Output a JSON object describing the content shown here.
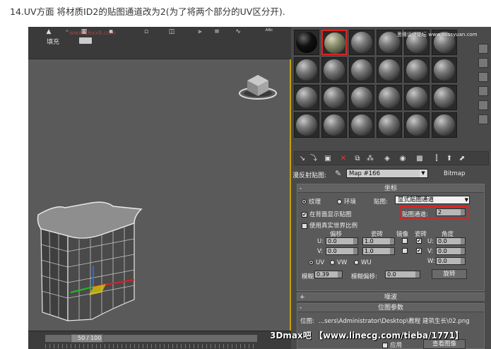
{
  "caption": "14.UV方面 将材质ID2的贴图通道改为2(为了将两个部分的UV区分开).",
  "viewport": {
    "fill_label": "填充",
    "watermark_text": "www.16xx8.com",
    "timeline_label": "50 / 100"
  },
  "material_editor": {
    "slot_watermark": "思缘设计论坛 www.missyuan.com",
    "map_row": {
      "label": "漫反射贴图:",
      "map_name": "Map #166",
      "map_type": "Bitmap"
    },
    "coords": {
      "title": "坐标",
      "mode_texture": "纹理",
      "mode_environ": "环境",
      "mapping_label": "贴图:",
      "mapping_value": "显式贴图通道",
      "show_on_back_label": "在背面显示贴图",
      "show_on_back": true,
      "channel_label": "贴图通道:",
      "channel_value": "2",
      "real_world_label": "使用真实世界比例",
      "col_offset": "偏移",
      "col_tiling": "瓷砖",
      "col_mirror": "镜像",
      "col_tile": "瓷砖",
      "col_angle": "角度",
      "u_label": "U:",
      "u_offset": "0.0",
      "u_tiling": "1.0",
      "u_angle": "0.0",
      "v_label": "V:",
      "v_offset": "0.0",
      "v_tiling": "1.0",
      "v_angle": "0.0",
      "w_label": "W:",
      "w_angle": "0.0",
      "uv": "UV",
      "vw": "VW",
      "wu": "WU",
      "blur_label": "模糊:",
      "blur_value": "0.39",
      "blur_offset_label": "模糊偏移:",
      "blur_offset_value": "0.0",
      "rotate_button": "旋转"
    },
    "noise_title": "噪波",
    "bitmap_params_title": "位图参数",
    "bitmap_label": "位图:",
    "bitmap_path": "...sers\\Administrator\\Desktop\\教程 建筑生长\\02.png",
    "apply_label": "应用",
    "view_image_label": "查看图像"
  },
  "credit": "3Dmax吧 【www.linecg.com/tieba/1771】",
  "colors": {
    "highlight": "#e02020",
    "viewport_bg": "#5a5a5a",
    "panel_bg": "#4a4a4a"
  }
}
